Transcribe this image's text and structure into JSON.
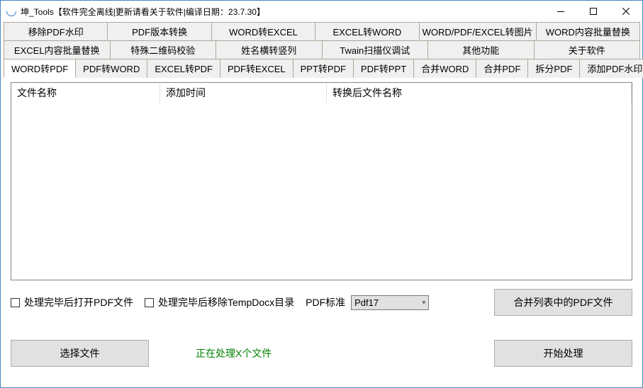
{
  "title": "坤_Tools【软件完全离线|更新请看关于软件|编译日期：23.7.30】",
  "tabs1": [
    "移除PDF水印",
    "PDF版本转换",
    "WORD转EXCEL",
    "EXCEL转WORD",
    "WORD/PDF/EXCEL转图片",
    "WORD内容批量替换"
  ],
  "tabs2": [
    "EXCEL内容批量替换",
    "特殊二维码校验",
    "姓名横转竖列",
    "Twain扫描仪调试",
    "其他功能",
    "关于软件"
  ],
  "tabs3": [
    "WORD转PDF",
    "PDF转WORD",
    "EXCEL转PDF",
    "PDF转EXCEL",
    "PPT转PDF",
    "PDF转PPT",
    "合并WORD",
    "合并PDF",
    "拆分PDF",
    "添加PDF水印"
  ],
  "columns": {
    "c1": "文件名称",
    "c2": "添加时间",
    "c3": "转换后文件名称"
  },
  "opts": {
    "openAfter": "处理完毕后打开PDF文件",
    "removeTemp": "处理完毕后移除TempDocx目录",
    "pdfStdLabel": "PDF标准",
    "pdfStdValue": "Pdf17"
  },
  "buttons": {
    "mergeList": "合并列表中的PDF文件",
    "selectFile": "选择文件",
    "start": "开始处理"
  },
  "status": "正在处理X个文件"
}
